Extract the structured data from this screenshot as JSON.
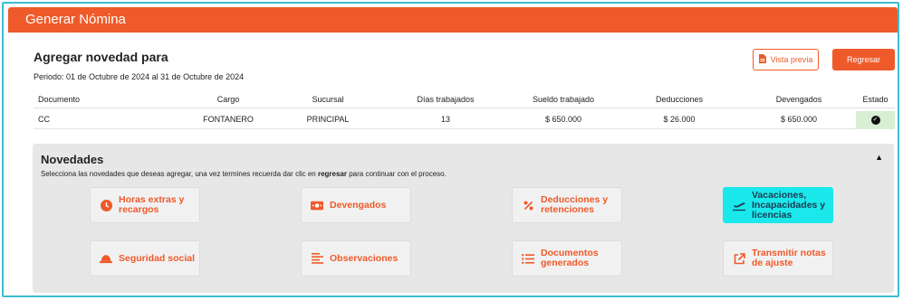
{
  "window": {
    "title": "Generar Nómina"
  },
  "header": {
    "title": "Agregar novedad para",
    "period": "Periodo: 01 de Octubre de 2024 al 31 de Octubre de 2024",
    "preview_label": "Vista previa",
    "back_label": "Regresar"
  },
  "table": {
    "columns": [
      "Documento",
      "Cargo",
      "Sucursal",
      "Días trabajados",
      "Sueldo trabajado",
      "Deducciones",
      "Devengados",
      "Estado"
    ],
    "row": {
      "documento": "CC",
      "cargo": "FONTANERO",
      "sucursal": "PRINCIPAL",
      "dias": "13",
      "sueldo": "$ 650.000",
      "deducciones": "$ 26.000",
      "devengados": "$ 650.000"
    }
  },
  "novedades": {
    "title": "Novedades",
    "subtitle_pre": "Selecciona las novedades que deseas agregar, una vez termines recuerda dar clic en ",
    "subtitle_bold": "regresar",
    "subtitle_post": " para continuar con el proceso.",
    "collapse_icon": "triangle-up",
    "cards": [
      {
        "label": "Horas extras y recargos",
        "icon": "clock-icon"
      },
      {
        "label": "Devengados",
        "icon": "money-icon"
      },
      {
        "label": "Deducciones y retenciones",
        "icon": "percent-icon"
      },
      {
        "label": "Vacaciones, Incapacidades y licencias",
        "icon": "plane-icon"
      },
      {
        "label": "Seguridad social",
        "icon": "helmet-icon"
      },
      {
        "label": "Observaciones",
        "icon": "align-left-icon"
      },
      {
        "label": "Documentos generados",
        "icon": "list-icon"
      },
      {
        "label": "Transmitir notas de ajuste",
        "icon": "external-link-icon"
      }
    ]
  },
  "colors": {
    "accent": "#ef5a2a",
    "highlight": "#1ae8ea",
    "status_ok_bg": "#d8efd4",
    "frame": "#3dbdd0"
  }
}
